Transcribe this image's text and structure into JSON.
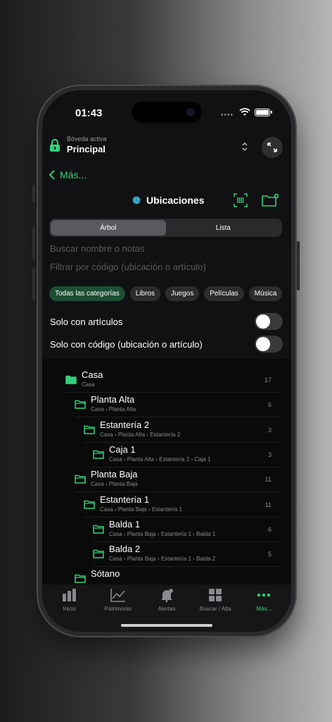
{
  "status": {
    "time": "01:43",
    "dots": "••••"
  },
  "vault": {
    "subtitle": "Bóveda activa",
    "name": "Principal"
  },
  "nav": {
    "back_label": "Más...",
    "title": "Ubicaciones"
  },
  "segments": [
    "Árbol",
    "Lista"
  ],
  "active_segment": "Árbol",
  "search": {
    "name_placeholder": "Buscar nombre o notas",
    "code_placeholder": "Filtrar por código (ubicación o artículo)"
  },
  "categories": [
    "Todas las categorías",
    "Libros",
    "Juegos",
    "Películas",
    "Música"
  ],
  "active_category": "Todas las categorías",
  "toggles": [
    {
      "label": "Solo con artículos",
      "on": false
    },
    {
      "label": "Solo con código (ubicación o artículo)",
      "on": false
    }
  ],
  "tree": [
    {
      "name": "Casa",
      "path": "Casa",
      "count": "17",
      "level": 0,
      "filled": true
    },
    {
      "name": "Planta Alta",
      "path": "Casa › Planta Alta",
      "count": "6",
      "level": 1,
      "filled": false
    },
    {
      "name": "Estantería 2",
      "path": "Casa › Planta Alta › Estantería 2",
      "count": "3",
      "level": 2,
      "filled": false
    },
    {
      "name": "Caja 1",
      "path": "Casa › Planta Alta › Estantería 2 › Caja 1",
      "count": "3",
      "level": 3,
      "filled": false
    },
    {
      "name": "Planta Baja",
      "path": "Casa › Planta Baja",
      "count": "11",
      "level": 1,
      "filled": false
    },
    {
      "name": "Estantería 1",
      "path": "Casa › Planta Baja › Estantería 1",
      "count": "11",
      "level": 2,
      "filled": false
    },
    {
      "name": "Balda 1",
      "path": "Casa › Planta Baja › Estantería 1 › Balda 1",
      "count": "6",
      "level": 3,
      "filled": false
    },
    {
      "name": "Balda 2",
      "path": "Casa › Planta Baja › Estantería 1 › Balda 2",
      "count": "5",
      "level": 3,
      "filled": false
    },
    {
      "name": "Sótano",
      "path": "",
      "count": "",
      "level": 1,
      "filled": false
    }
  ],
  "tabs": [
    {
      "label": "Inicio",
      "icon": "home-bars-icon"
    },
    {
      "label": "Patrimonio",
      "icon": "chart-line-icon"
    },
    {
      "label": "Alertas",
      "icon": "bell-icon"
    },
    {
      "label": "Buscar / Alta",
      "icon": "grid-icon"
    },
    {
      "label": "Más...",
      "icon": "more-dots-icon"
    }
  ],
  "active_tab": "Más...",
  "colors": {
    "accent": "#33d17a",
    "chip_active": "#1c4f33",
    "background": "#111113"
  }
}
